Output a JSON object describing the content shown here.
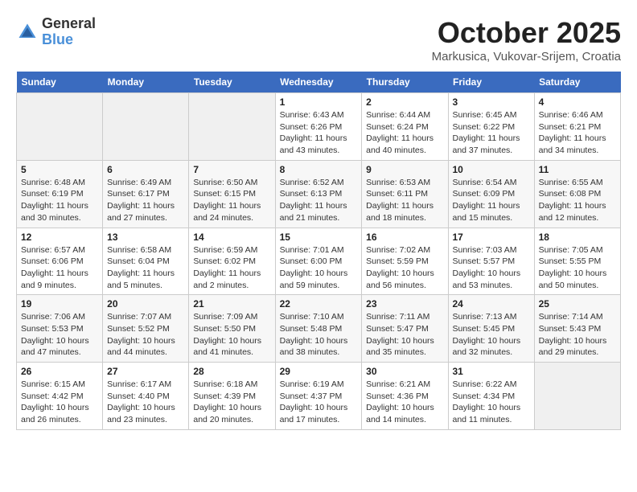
{
  "header": {
    "logo_general": "General",
    "logo_blue": "Blue",
    "month_title": "October 2025",
    "location": "Markusica, Vukovar-Srijem, Croatia"
  },
  "days_of_week": [
    "Sunday",
    "Monday",
    "Tuesday",
    "Wednesday",
    "Thursday",
    "Friday",
    "Saturday"
  ],
  "weeks": [
    [
      {
        "num": "",
        "detail": ""
      },
      {
        "num": "",
        "detail": ""
      },
      {
        "num": "",
        "detail": ""
      },
      {
        "num": "1",
        "detail": "Sunrise: 6:43 AM\nSunset: 6:26 PM\nDaylight: 11 hours and 43 minutes."
      },
      {
        "num": "2",
        "detail": "Sunrise: 6:44 AM\nSunset: 6:24 PM\nDaylight: 11 hours and 40 minutes."
      },
      {
        "num": "3",
        "detail": "Sunrise: 6:45 AM\nSunset: 6:22 PM\nDaylight: 11 hours and 37 minutes."
      },
      {
        "num": "4",
        "detail": "Sunrise: 6:46 AM\nSunset: 6:21 PM\nDaylight: 11 hours and 34 minutes."
      }
    ],
    [
      {
        "num": "5",
        "detail": "Sunrise: 6:48 AM\nSunset: 6:19 PM\nDaylight: 11 hours and 30 minutes."
      },
      {
        "num": "6",
        "detail": "Sunrise: 6:49 AM\nSunset: 6:17 PM\nDaylight: 11 hours and 27 minutes."
      },
      {
        "num": "7",
        "detail": "Sunrise: 6:50 AM\nSunset: 6:15 PM\nDaylight: 11 hours and 24 minutes."
      },
      {
        "num": "8",
        "detail": "Sunrise: 6:52 AM\nSunset: 6:13 PM\nDaylight: 11 hours and 21 minutes."
      },
      {
        "num": "9",
        "detail": "Sunrise: 6:53 AM\nSunset: 6:11 PM\nDaylight: 11 hours and 18 minutes."
      },
      {
        "num": "10",
        "detail": "Sunrise: 6:54 AM\nSunset: 6:09 PM\nDaylight: 11 hours and 15 minutes."
      },
      {
        "num": "11",
        "detail": "Sunrise: 6:55 AM\nSunset: 6:08 PM\nDaylight: 11 hours and 12 minutes."
      }
    ],
    [
      {
        "num": "12",
        "detail": "Sunrise: 6:57 AM\nSunset: 6:06 PM\nDaylight: 11 hours and 9 minutes."
      },
      {
        "num": "13",
        "detail": "Sunrise: 6:58 AM\nSunset: 6:04 PM\nDaylight: 11 hours and 5 minutes."
      },
      {
        "num": "14",
        "detail": "Sunrise: 6:59 AM\nSunset: 6:02 PM\nDaylight: 11 hours and 2 minutes."
      },
      {
        "num": "15",
        "detail": "Sunrise: 7:01 AM\nSunset: 6:00 PM\nDaylight: 10 hours and 59 minutes."
      },
      {
        "num": "16",
        "detail": "Sunrise: 7:02 AM\nSunset: 5:59 PM\nDaylight: 10 hours and 56 minutes."
      },
      {
        "num": "17",
        "detail": "Sunrise: 7:03 AM\nSunset: 5:57 PM\nDaylight: 10 hours and 53 minutes."
      },
      {
        "num": "18",
        "detail": "Sunrise: 7:05 AM\nSunset: 5:55 PM\nDaylight: 10 hours and 50 minutes."
      }
    ],
    [
      {
        "num": "19",
        "detail": "Sunrise: 7:06 AM\nSunset: 5:53 PM\nDaylight: 10 hours and 47 minutes."
      },
      {
        "num": "20",
        "detail": "Sunrise: 7:07 AM\nSunset: 5:52 PM\nDaylight: 10 hours and 44 minutes."
      },
      {
        "num": "21",
        "detail": "Sunrise: 7:09 AM\nSunset: 5:50 PM\nDaylight: 10 hours and 41 minutes."
      },
      {
        "num": "22",
        "detail": "Sunrise: 7:10 AM\nSunset: 5:48 PM\nDaylight: 10 hours and 38 minutes."
      },
      {
        "num": "23",
        "detail": "Sunrise: 7:11 AM\nSunset: 5:47 PM\nDaylight: 10 hours and 35 minutes."
      },
      {
        "num": "24",
        "detail": "Sunrise: 7:13 AM\nSunset: 5:45 PM\nDaylight: 10 hours and 32 minutes."
      },
      {
        "num": "25",
        "detail": "Sunrise: 7:14 AM\nSunset: 5:43 PM\nDaylight: 10 hours and 29 minutes."
      }
    ],
    [
      {
        "num": "26",
        "detail": "Sunrise: 6:15 AM\nSunset: 4:42 PM\nDaylight: 10 hours and 26 minutes."
      },
      {
        "num": "27",
        "detail": "Sunrise: 6:17 AM\nSunset: 4:40 PM\nDaylight: 10 hours and 23 minutes."
      },
      {
        "num": "28",
        "detail": "Sunrise: 6:18 AM\nSunset: 4:39 PM\nDaylight: 10 hours and 20 minutes."
      },
      {
        "num": "29",
        "detail": "Sunrise: 6:19 AM\nSunset: 4:37 PM\nDaylight: 10 hours and 17 minutes."
      },
      {
        "num": "30",
        "detail": "Sunrise: 6:21 AM\nSunset: 4:36 PM\nDaylight: 10 hours and 14 minutes."
      },
      {
        "num": "31",
        "detail": "Sunrise: 6:22 AM\nSunset: 4:34 PM\nDaylight: 10 hours and 11 minutes."
      },
      {
        "num": "",
        "detail": ""
      }
    ]
  ]
}
